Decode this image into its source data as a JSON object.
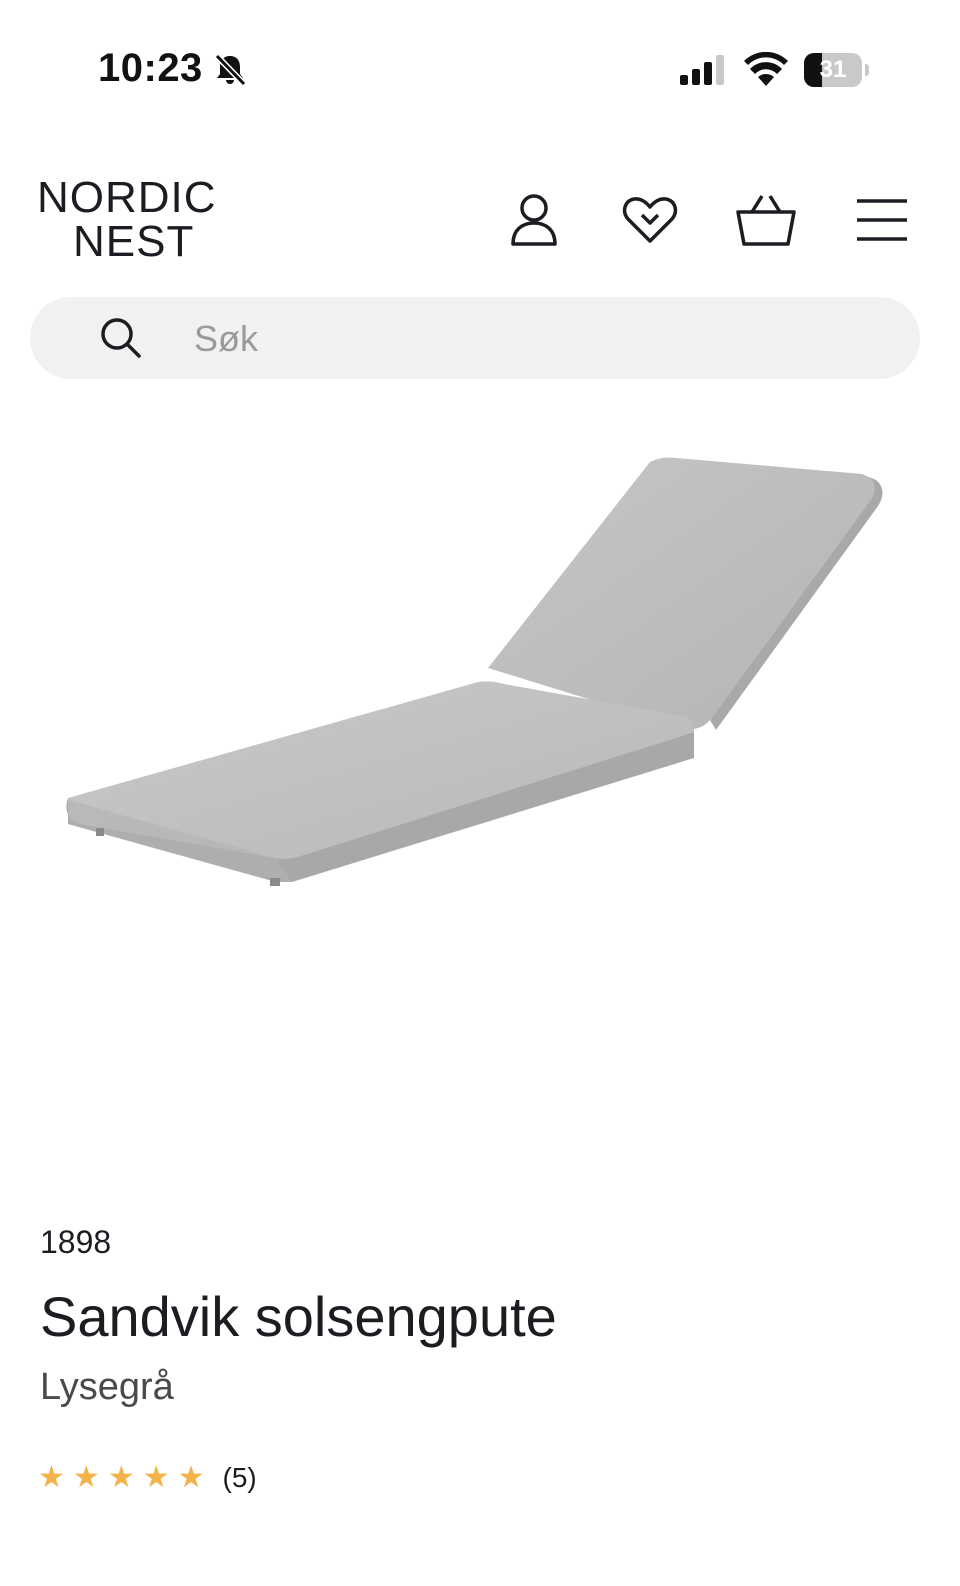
{
  "status_bar": {
    "time": "10:23",
    "battery_level": "31",
    "battery_fraction": 0.31,
    "icons": [
      "bell-muted-icon",
      "cellular-signal-icon",
      "wifi-icon",
      "battery-icon"
    ]
  },
  "header": {
    "logo_line1": "NORDIC",
    "logo_line2": "NEST",
    "icons": [
      "account-icon",
      "wishlist-heart-icon",
      "basket-icon",
      "menu-icon"
    ]
  },
  "search": {
    "placeholder": "Søk",
    "value": ""
  },
  "product": {
    "image": "grey sun lounger cushion",
    "brand": "1898",
    "title": "Sandvik solsengpute",
    "variant": "Lysegrå",
    "rating": 5,
    "rating_max": 5,
    "review_count": "(5)",
    "star_color": "#f3b24a"
  },
  "colors": {
    "text": "#1c1d22",
    "search_bg": "#f1f1f1",
    "cushion": "#bdbdbd"
  }
}
